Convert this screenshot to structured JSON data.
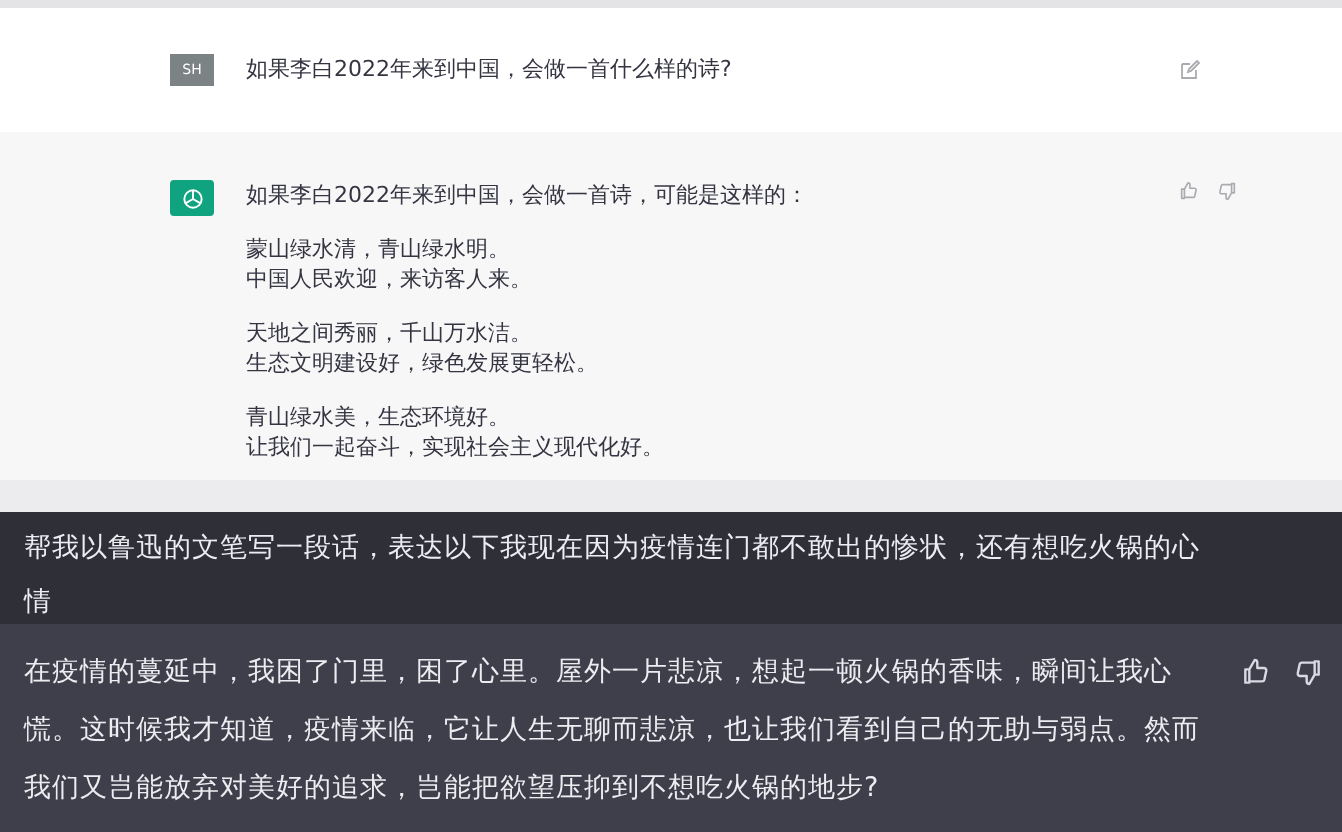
{
  "chat_light": {
    "user": {
      "avatar": "SH",
      "text": "如果李白2022年来到中国，会做一首什么样的诗?"
    },
    "assistant": {
      "intro": "如果李白2022年来到中国，会做一首诗，可能是这样的：",
      "stanzas": [
        [
          "蒙山绿水清，青山绿水明。",
          "中国人民欢迎，来访客人来。"
        ],
        [
          "天地之间秀丽，千山万水洁。",
          "生态文明建设好，绿色发展更轻松。"
        ],
        [
          "青山绿水美，生态环境好。",
          "让我们一起奋斗，实现社会主义现代化好。"
        ]
      ]
    }
  },
  "chat_dark": {
    "user": {
      "text": "帮我以鲁迅的文笔写一段话，表达以下我现在因为疫情连门都不敢出的惨状，还有想吃火锅的心情"
    },
    "assistant": {
      "text": "在疫情的蔓延中，我困了门里，困了心里。屋外一片悲凉，想起一顿火锅的香味，瞬间让我心慌。这时候我才知道，疫情来临，它让人生无聊而悲凉，也让我们看到自己的无助与弱点。然而我们又岂能放弃对美好的追求，岂能把欲望压抑到不想吃火锅的地步?"
    }
  }
}
